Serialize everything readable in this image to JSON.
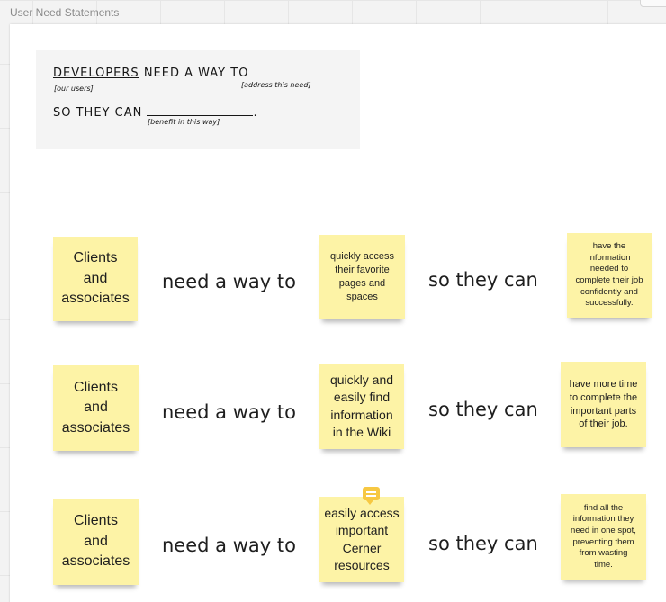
{
  "frame": {
    "title": "User Need Statements"
  },
  "template": {
    "subject": "DEVELOPERS",
    "phrase1": "NEED A WAY TO",
    "phrase2": "SO THEY CAN",
    "hint_users": "[our users]",
    "hint_need": "[address this need]",
    "hint_benefit": "[benefit in this way]"
  },
  "rows": [
    {
      "who": [
        "Clients",
        "and",
        "associates"
      ],
      "connector1": "need a way to",
      "need": [
        "quickly access",
        "their favorite",
        "pages and",
        "spaces"
      ],
      "connector2": "so they can",
      "benefit": [
        "have the",
        "information",
        "needed to",
        "complete their job",
        "confidently and",
        "successfully."
      ]
    },
    {
      "who": [
        "Clients",
        "and",
        "associates"
      ],
      "connector1": "need a way to",
      "need": [
        "quickly and",
        "easily find",
        "information",
        "in the Wiki"
      ],
      "connector2": "so they can",
      "benefit": [
        "have more time",
        "to complete the",
        "important parts",
        "of their job."
      ]
    },
    {
      "who": [
        "Clients",
        "and",
        "associates"
      ],
      "connector1": "need a way to",
      "need": [
        "easily access",
        "important",
        "Cerner",
        "resources"
      ],
      "connector2": "so they can",
      "benefit": [
        "find all the",
        "information they",
        "need in one spot,",
        "preventing them",
        "from wasting",
        "time."
      ]
    }
  ],
  "colors": {
    "sticky": "#fdf3a6",
    "comment_badge": "#f7c842",
    "canvas": "#f3f3f3"
  },
  "icons": {
    "comment": "comment-icon"
  }
}
